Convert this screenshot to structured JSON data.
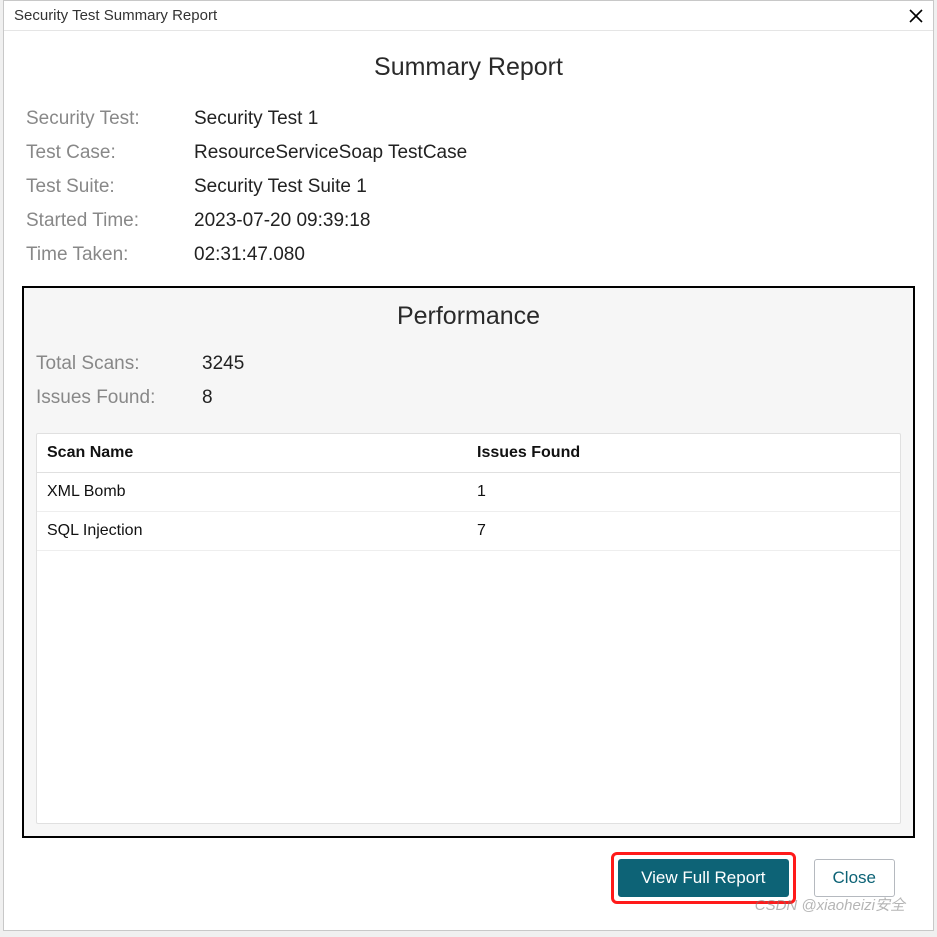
{
  "window": {
    "title": "Security Test Summary Report"
  },
  "report": {
    "heading": "Summary Report",
    "meta": {
      "security_test": {
        "label": "Security Test:",
        "value": "Security Test 1"
      },
      "test_case": {
        "label": "Test Case:",
        "value": "ResourceServiceSoap TestCase"
      },
      "test_suite": {
        "label": "Test Suite:",
        "value": "Security Test Suite 1"
      },
      "started_time": {
        "label": "Started Time:",
        "value": "2023-07-20 09:39:18"
      },
      "time_taken": {
        "label": "Time Taken:",
        "value": "02:31:47.080"
      }
    }
  },
  "performance": {
    "heading": "Performance",
    "total_scans": {
      "label": "Total Scans:",
      "value": "3245"
    },
    "issues_found": {
      "label": "Issues Found:",
      "value": "8"
    },
    "table": {
      "col_scan_name": "Scan Name",
      "col_issues": "Issues Found",
      "rows": [
        {
          "name": "XML Bomb",
          "issues": "1"
        },
        {
          "name": "SQL Injection",
          "issues": "7"
        }
      ]
    }
  },
  "footer": {
    "view_full_report": "View Full Report",
    "close": "Close"
  },
  "watermark": "CSDN @xiaoheizi安全"
}
